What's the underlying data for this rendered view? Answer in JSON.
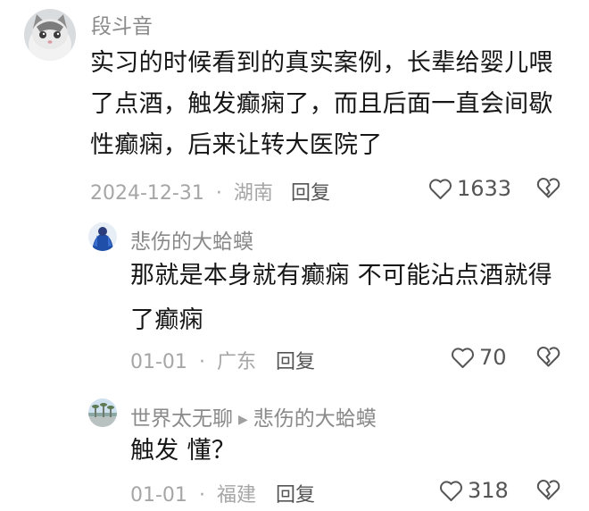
{
  "comments": [
    {
      "username": "段斗音",
      "avatar_icon": "cat-avatar",
      "text_lines": [
        "实习的时候看到的真实案例，长辈给婴儿喂",
        "了点酒，触发癫痫了，而且后面一直会间歇",
        "性癫痫，后来让转大医院了"
      ],
      "date": "2024-12-31",
      "location": "湖南",
      "reply_label": "回复",
      "likes": "1633"
    },
    {
      "username": "悲伤的大蛤蟆",
      "avatar_icon": "figure-avatar",
      "text_lines": [
        "那就是本身就有癫痫 不可能沾点酒就得",
        "了癫痫"
      ],
      "date": "01-01",
      "location": "广东",
      "reply_label": "回复",
      "likes": "70"
    },
    {
      "username": "世界太无聊",
      "reply_to": "悲伤的大蛤蟆",
      "avatar_icon": "landscape-avatar",
      "text_lines": [
        "触发 懂？"
      ],
      "date": "01-01",
      "location": "福建",
      "reply_label": "回复",
      "likes": "318"
    }
  ],
  "separator": "·",
  "colors": {
    "username": "#8a8a8a",
    "meta": "#a6a6a6",
    "body": "#161616"
  }
}
